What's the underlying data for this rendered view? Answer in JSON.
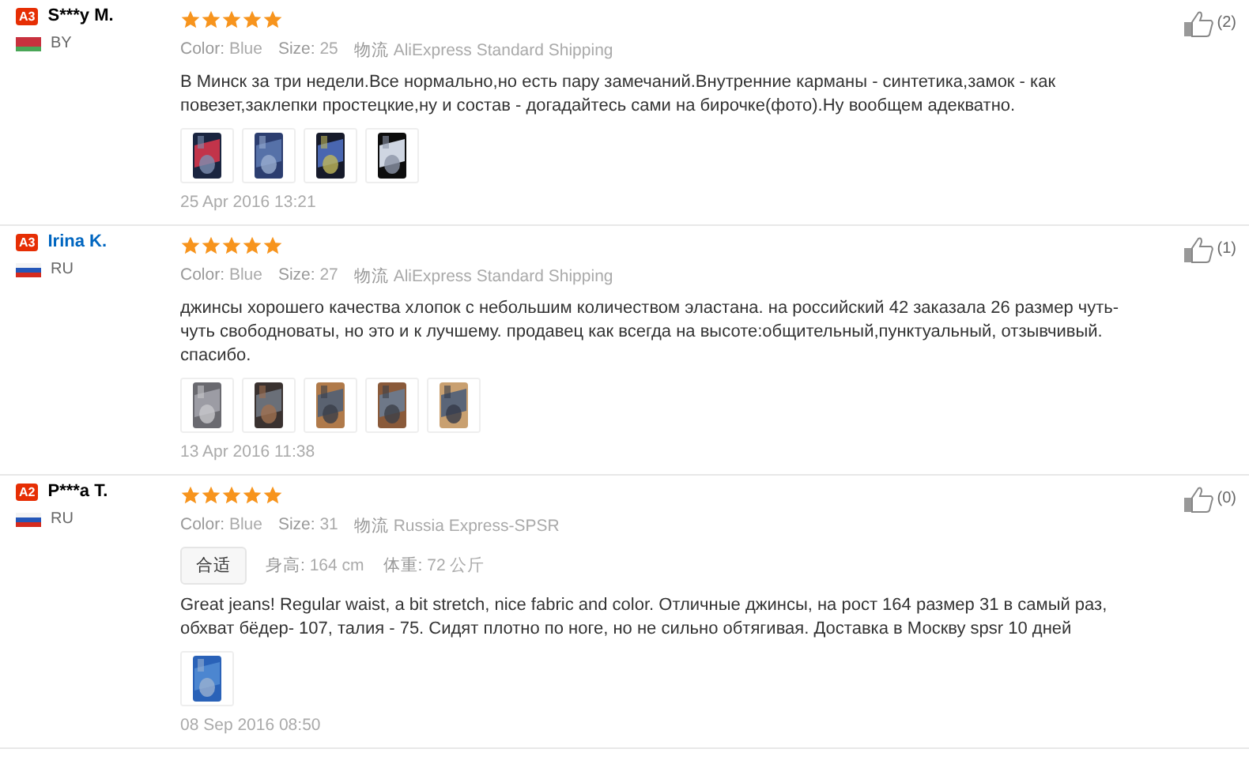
{
  "reviews": [
    {
      "badge": "A3",
      "name": "S***y M.",
      "linked": false,
      "flag": {
        "kind": "by"
      },
      "country": "BY",
      "stars": 5,
      "specs": [
        {
          "label": "Color:",
          "value": "Blue"
        },
        {
          "label": "Size:",
          "value": "25"
        },
        {
          "label": "物流",
          "value": "AliExpress Standard Shipping"
        }
      ],
      "text": "В Минск за три недели.Все нормально,но есть пару замечаний.Внутренние карманы - синтетика,замок - как повезет,заклепки простецкие,ну и состав - догадайтесь сами на бирочке(фото).Ну вообщем адекватно.",
      "photos": [
        {
          "kind": "picture"
        },
        {
          "kind": "picture"
        },
        {
          "kind": "picture"
        },
        {
          "kind": "picture"
        }
      ],
      "date": "25 Apr 2016 13:21",
      "likes": "(2)"
    },
    {
      "badge": "A3",
      "name": "Irina K.",
      "linked": true,
      "flag": {
        "kind": "ru"
      },
      "country": "RU",
      "stars": 5,
      "specs": [
        {
          "label": "Color:",
          "value": "Blue"
        },
        {
          "label": "Size:",
          "value": "27"
        },
        {
          "label": "物流",
          "value": "AliExpress Standard Shipping"
        }
      ],
      "text": "джинсы хорошего качества хлопок с небольшим количеством эластана. на российский 42 заказала 26 размер чуть- чуть свободноваты, но это и к лучшему. продавец как всегда на высоте:общительный,пунктуальный, отзывчивый. спасибо.",
      "photos": [
        {
          "kind": "picture"
        },
        {
          "kind": "picture"
        },
        {
          "kind": "picture"
        },
        {
          "kind": "picture"
        },
        {
          "kind": "picture"
        }
      ],
      "date": "13 Apr 2016 11:38",
      "likes": "(1)"
    },
    {
      "badge": "A2",
      "name": "P***a T.",
      "linked": false,
      "flag": {
        "kind": "ru"
      },
      "country": "RU",
      "stars": 5,
      "specs": [
        {
          "label": "Color:",
          "value": "Blue"
        },
        {
          "label": "Size:",
          "value": "31"
        },
        {
          "label": "物流",
          "value": "Russia Express-SPSR"
        }
      ],
      "fit": {
        "tag": "合适",
        "attributes": [
          {
            "label": "身高:",
            "value": "164 cm"
          },
          {
            "label": "体重:",
            "value": "72 公斤"
          }
        ]
      },
      "text": "Great jeans! Regular waist, a bit stretch, nice fabric and color. Отличные джинсы, на рост 164 размер 31 в самый раз, обхват бёдер- 107, талия - 75. Сидят плотно по ноге, но не сильно обтягивая. Доставка в Москву spsr 10 дней",
      "photos": [
        {
          "kind": "picture"
        }
      ],
      "date": "08 Sep 2016 08:50",
      "likes": "(0)"
    }
  ]
}
